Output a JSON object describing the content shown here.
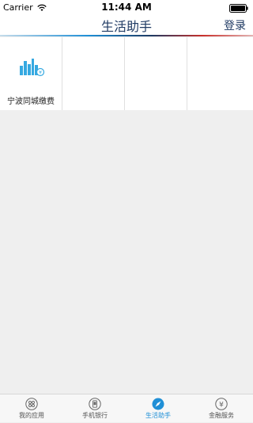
{
  "status_bar": {
    "carrier": "Carrier",
    "time": "11:44 AM"
  },
  "nav": {
    "title": "生活助手",
    "login": "登录"
  },
  "grid": {
    "items": [
      {
        "label": "宁波同城缴费",
        "icon": "city-skyline-icon"
      },
      {
        "label": "",
        "icon": ""
      },
      {
        "label": "",
        "icon": ""
      },
      {
        "label": "",
        "icon": ""
      }
    ]
  },
  "tabs": [
    {
      "label": "我的应用",
      "icon": "apps-grid-icon",
      "active": false
    },
    {
      "label": "手机银行",
      "icon": "phone-bank-icon",
      "active": false
    },
    {
      "label": "生活助手",
      "icon": "compass-icon",
      "active": true
    },
    {
      "label": "金融服务",
      "icon": "yuan-icon",
      "active": false
    }
  ],
  "colors": {
    "accent_blue": "#1f8fd6",
    "nav_text": "#1f3a63",
    "accent_red": "#c9302c"
  }
}
